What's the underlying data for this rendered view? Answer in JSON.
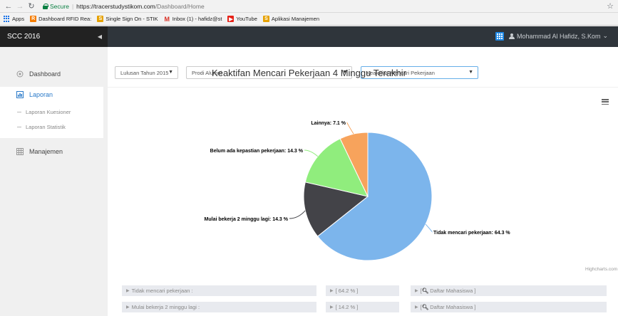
{
  "browser": {
    "secure_label": "Secure",
    "url_host": "https://tracerstudystikom.com",
    "url_path": "/Dashboard/Home",
    "bookmarks": [
      "Apps",
      "Dashboard RFID Rea:",
      "Single Sign On - STIK",
      "Inbox (1) - hafidz@st",
      "YouTube",
      "Aplikasi Manajemen"
    ]
  },
  "header": {
    "brand": "SCC 2016",
    "user": "Mohammad Al Hafidz, S.Kom"
  },
  "sidebar": {
    "dashboard": "Dashboard",
    "laporan": "Laporan",
    "laporan_kuesioner": "Laporan Kuesioner",
    "laporan_statistik": "Laporan Statistik",
    "manajemen": "Manajemen"
  },
  "filters": {
    "tahun": "Lulusan Tahun 2015",
    "prodi": "Prodi Alumni . . .",
    "kategori": "Keaktifan Mencari Pekerjaan"
  },
  "chart_data": {
    "type": "pie",
    "title": "Keaktifan Mencari Pekerjaan 4 Minggu Terakhir",
    "credit": "Highcharts.com",
    "slices": [
      {
        "name": "Tidak mencari pekerjaan",
        "value": 64.3,
        "color": "#7cb5ec"
      },
      {
        "name": "Mulai bekerja 2 minggu lagi",
        "value": 14.3,
        "color": "#434348"
      },
      {
        "name": "Belum ada kepastian pekerjaan",
        "value": 14.3,
        "color": "#90ed7d"
      },
      {
        "name": "Lainnya",
        "value": 7.1,
        "color": "#f7a35c"
      }
    ],
    "labels": [
      "Tidak mencari pekerjaan: 64.3 %",
      "Mulai bekerja 2 minggu lagi: 14.3 %",
      "Belum ada kepastian pekerjaan: 14.3 %",
      "Lainnya: 7.1 %"
    ]
  },
  "table": {
    "rows": [
      {
        "label": "Tidak mencari pekerjaan :",
        "percent": "[ 64.2 % ]",
        "link": "Daftar Mahasiswa ]",
        "link_prefix": "[ "
      },
      {
        "label": "Mulai bekerja 2 minggu lagi :",
        "percent": "[ 14.2 % ]",
        "link": "Daftar Mahasiswa ]",
        "link_prefix": "[ "
      }
    ]
  }
}
